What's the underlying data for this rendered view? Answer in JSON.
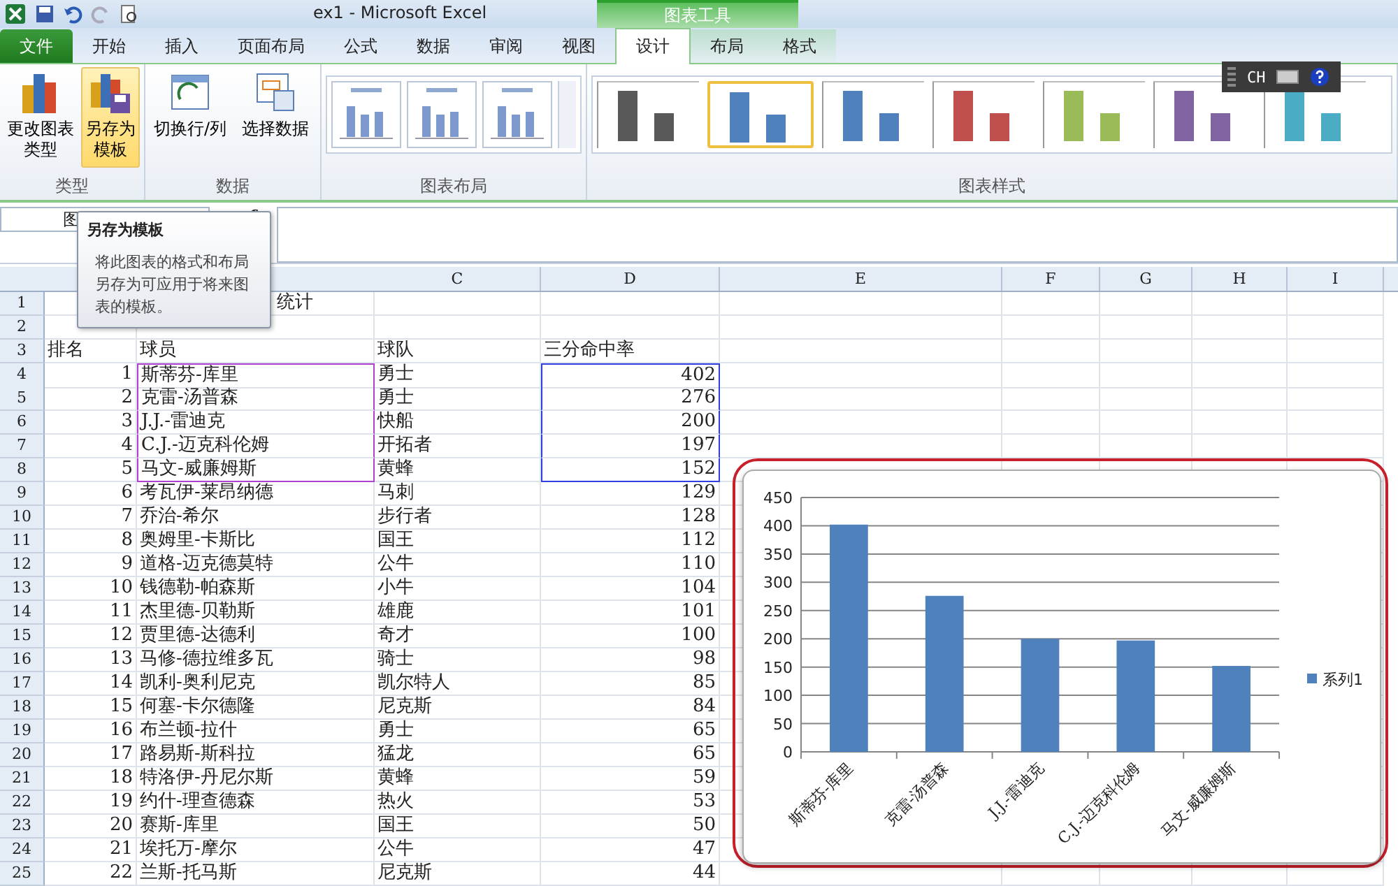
{
  "window": {
    "title": "ex1  -  Microsoft Excel",
    "context_title": "图表工具"
  },
  "ime_bar": {
    "label": "CH"
  },
  "tabs": [
    {
      "label": "文件",
      "kind": "file",
      "selected": false
    },
    {
      "label": "开始",
      "kind": "main",
      "selected": false
    },
    {
      "label": "插入",
      "kind": "main",
      "selected": false
    },
    {
      "label": "页面布局",
      "kind": "main",
      "selected": false
    },
    {
      "label": "公式",
      "kind": "main",
      "selected": false
    },
    {
      "label": "数据",
      "kind": "main",
      "selected": false
    },
    {
      "label": "审阅",
      "kind": "main",
      "selected": false
    },
    {
      "label": "视图",
      "kind": "main",
      "selected": false
    },
    {
      "label": "设计",
      "kind": "context",
      "selected": true
    },
    {
      "label": "布局",
      "kind": "context",
      "selected": false
    },
    {
      "label": "格式",
      "kind": "context",
      "selected": false
    }
  ],
  "ribbon": {
    "groups": [
      {
        "label": "类型",
        "buttons": [
          {
            "label": "更改图表类型",
            "selected": false
          },
          {
            "label": "另存为模板",
            "selected": true
          }
        ]
      },
      {
        "label": "数据",
        "buttons": [
          {
            "label": "切换行/列",
            "selected": false
          },
          {
            "label": "选择数据",
            "selected": false
          }
        ]
      }
    ],
    "layout_group": {
      "label": "图表布局"
    },
    "style_group": {
      "label": "图表样式",
      "styles": [
        {
          "color": "#595959",
          "selected": false
        },
        {
          "color": "#4f81bd",
          "selected": true
        },
        {
          "color": "#4f81bd",
          "selected": false
        },
        {
          "color": "#c0504d",
          "selected": false
        },
        {
          "color": "#9bbb59",
          "selected": false
        },
        {
          "color": "#8064a2",
          "selected": false
        },
        {
          "color": "#4bacc6",
          "selected": false
        }
      ]
    }
  },
  "name_box": {
    "value": "图"
  },
  "tooltip": {
    "title": "另存为模板",
    "body": "将此图表的格式和布局另存为可应用于将来图表的模板。"
  },
  "sheet": {
    "columns": [
      "C",
      "D",
      "E",
      "F",
      "G",
      "H",
      "I"
    ],
    "title_row": {
      "row": "1",
      "text": "统计"
    },
    "blank_row": {
      "row": "2"
    },
    "header_row": {
      "row": "3",
      "cells": [
        "排名",
        "球员",
        "球队",
        "三分命中率"
      ]
    },
    "rows": [
      {
        "row": "4",
        "rank": "1",
        "player": "斯蒂芬-库里",
        "team": "勇士",
        "value": "402",
        "in_chart": true
      },
      {
        "row": "5",
        "rank": "2",
        "player": "克雷-汤普森",
        "team": "勇士",
        "value": "276",
        "in_chart": true
      },
      {
        "row": "6",
        "rank": "3",
        "player": "J.J.-雷迪克",
        "team": "快船",
        "value": "200",
        "in_chart": true
      },
      {
        "row": "7",
        "rank": "4",
        "player": "C.J.-迈克科伦姆",
        "team": "开拓者",
        "value": "197",
        "in_chart": true
      },
      {
        "row": "8",
        "rank": "5",
        "player": "马文-威廉姆斯",
        "team": "黄蜂",
        "value": "152",
        "in_chart": true
      },
      {
        "row": "9",
        "rank": "6",
        "player": "考瓦伊-莱昂纳德",
        "team": "马刺",
        "value": "129",
        "in_chart": false
      },
      {
        "row": "10",
        "rank": "7",
        "player": "乔治-希尔",
        "team": "步行者",
        "value": "128",
        "in_chart": false
      },
      {
        "row": "11",
        "rank": "8",
        "player": "奥姆里-卡斯比",
        "team": "国王",
        "value": "112",
        "in_chart": false
      },
      {
        "row": "12",
        "rank": "9",
        "player": "道格-迈克德莫特",
        "team": "公牛",
        "value": "110",
        "in_chart": false
      },
      {
        "row": "13",
        "rank": "10",
        "player": "钱德勒-帕森斯",
        "team": "小牛",
        "value": "104",
        "in_chart": false
      },
      {
        "row": "14",
        "rank": "11",
        "player": "杰里德-贝勒斯",
        "team": "雄鹿",
        "value": "101",
        "in_chart": false
      },
      {
        "row": "15",
        "rank": "12",
        "player": "贾里德-达德利",
        "team": "奇才",
        "value": "100",
        "in_chart": false
      },
      {
        "row": "16",
        "rank": "13",
        "player": "马修-德拉维多瓦",
        "team": "骑士",
        "value": "98",
        "in_chart": false
      },
      {
        "row": "17",
        "rank": "14",
        "player": "凯利-奥利尼克",
        "team": "凯尔特人",
        "value": "85",
        "in_chart": false
      },
      {
        "row": "18",
        "rank": "15",
        "player": "何塞-卡尔德隆",
        "team": "尼克斯",
        "value": "84",
        "in_chart": false
      },
      {
        "row": "19",
        "rank": "16",
        "player": "布兰顿-拉什",
        "team": "勇士",
        "value": "65",
        "in_chart": false
      },
      {
        "row": "20",
        "rank": "17",
        "player": "路易斯-斯科拉",
        "team": "猛龙",
        "value": "65",
        "in_chart": false
      },
      {
        "row": "21",
        "rank": "18",
        "player": "特洛伊-丹尼尔斯",
        "team": "黄蜂",
        "value": "59",
        "in_chart": false
      },
      {
        "row": "22",
        "rank": "19",
        "player": "约什-理查德森",
        "team": "热火",
        "value": "53",
        "in_chart": false
      },
      {
        "row": "23",
        "rank": "20",
        "player": "赛斯-库里",
        "team": "国王",
        "value": "50",
        "in_chart": false
      },
      {
        "row": "24",
        "rank": "21",
        "player": "埃托万-摩尔",
        "team": "公牛",
        "value": "47",
        "in_chart": false
      },
      {
        "row": "25",
        "rank": "22",
        "player": "兰斯-托马斯",
        "team": "尼克斯",
        "value": "44",
        "in_chart": false
      }
    ]
  },
  "chart": {
    "chart_data": {
      "type": "bar",
      "categories": [
        "斯蒂芬-库里",
        "克雷-汤普森",
        "J.J.-雷迪克",
        "C.J.-迈克科伦姆",
        "马文-威廉姆斯"
      ],
      "series": [
        {
          "name": "系列1",
          "color": "#4f81bd",
          "values": [
            402,
            276,
            200,
            197,
            152
          ]
        }
      ],
      "ylim": [
        0,
        450
      ],
      "yticks": [
        0,
        50,
        100,
        150,
        200,
        250,
        300,
        350,
        400,
        450
      ],
      "grid": true
    }
  }
}
